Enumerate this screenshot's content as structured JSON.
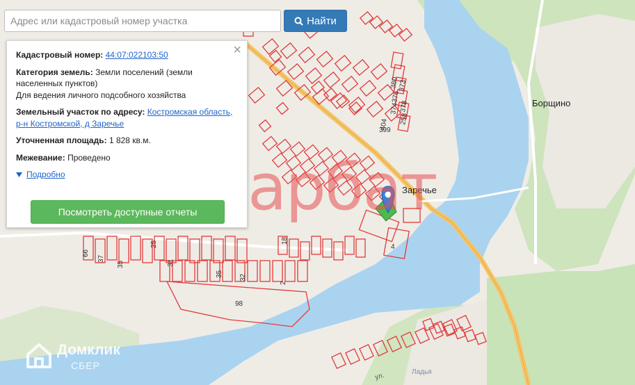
{
  "search": {
    "placeholder": "Адрес или кадастровый номер участка",
    "button_label": "Найти"
  },
  "info": {
    "cadastral_label": "Кадастровый номер:",
    "cadastral_value": "44:07:022103:50",
    "category_label": "Категория земель:",
    "category_value": "Земли поселений (земли населенных пунктов)",
    "purpose": "Для ведения личного подсобного хозяйства",
    "address_label": "Земельный участок по адресу:",
    "address_value": "Костромская область, р-н Костромской, д Заречье",
    "area_label": "Уточненная площадь:",
    "area_value": "1 828 кв.м.",
    "survey_label": "Межевание:",
    "survey_value": "Проведено",
    "details_link": "Подробно",
    "reports_button": "Посмотреть доступные отчеты",
    "close_symbol": "×"
  },
  "map": {
    "place_labels": [
      "Заречье",
      "Борщино"
    ],
    "water_label": "Ладья",
    "street_label": "ул.",
    "parcel_numbers": [
      "380",
      "373",
      "376",
      "374",
      "378",
      "404",
      "258",
      "399",
      "25",
      "31",
      "35",
      "37",
      "66",
      "18",
      "4",
      "35",
      "32",
      "2",
      "98"
    ],
    "colors": {
      "background": "#efece6",
      "water": "#aad3f0",
      "forest": "#c9e3b8",
      "parcel_outline": "#e03b3b",
      "road": "#f4c56b",
      "marker": "#3d7fd6",
      "selected_parcel": "#4cbb4c"
    }
  },
  "watermark": {
    "text": "арбат"
  },
  "branding": {
    "name": "Домклик",
    "sub": "СБЕР"
  }
}
